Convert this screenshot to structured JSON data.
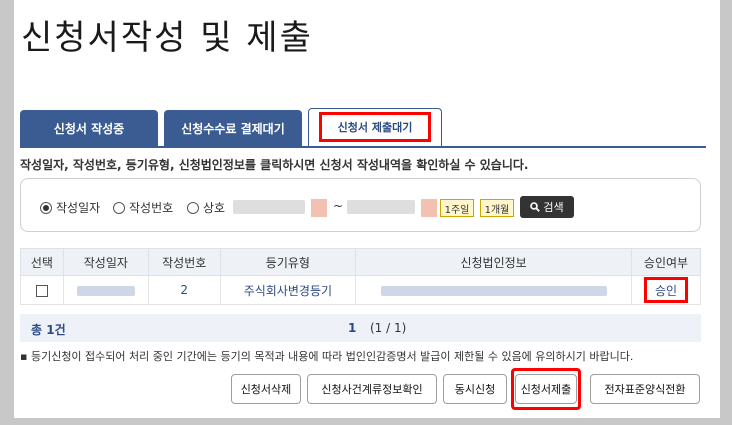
{
  "page": {
    "title": "신청서작성 및 제출"
  },
  "tabs": [
    {
      "label": "신청서 작성중"
    },
    {
      "label": "신청수수료 결제대기"
    },
    {
      "label": "신청서 제출대기"
    }
  ],
  "info_text": "작성일자, 작성번호, 등기유형, 신청법인정보를 클릭하시면 신청서 작성내역을 확인하실 수 있습니다.",
  "search": {
    "options": [
      {
        "label": "작성일자",
        "selected": true
      },
      {
        "label": "작성번호",
        "selected": false
      },
      {
        "label": "상호",
        "selected": false
      }
    ],
    "separator": "~",
    "period_1week": "1주일",
    "period_1month": "1개월",
    "search_label": "검색"
  },
  "table": {
    "headers": [
      "선택",
      "작성일자",
      "작성번호",
      "등기유형",
      "신청법인정보",
      "승인여부"
    ],
    "rows": [
      {
        "number": "2",
        "type": "주식회사변경등기",
        "approval": "승인"
      }
    ]
  },
  "pagination": {
    "total_label": "총",
    "total_count": "1",
    "total_unit": "건",
    "current": "1",
    "info": "(1 / 1)"
  },
  "notice": "등기신청이 접수되어 처리 중인 기간에는 등기의 목적과 내용에 따라 법인인감증명서 발급이 제한될 수 있음에 유의하시기 바랍니다.",
  "buttons": {
    "delete": "신청서삭제",
    "check": "신청사건계류정보확인",
    "simultaneous": "동시신청",
    "submit": "신청서제출",
    "convert": "전자표준양식전환"
  }
}
